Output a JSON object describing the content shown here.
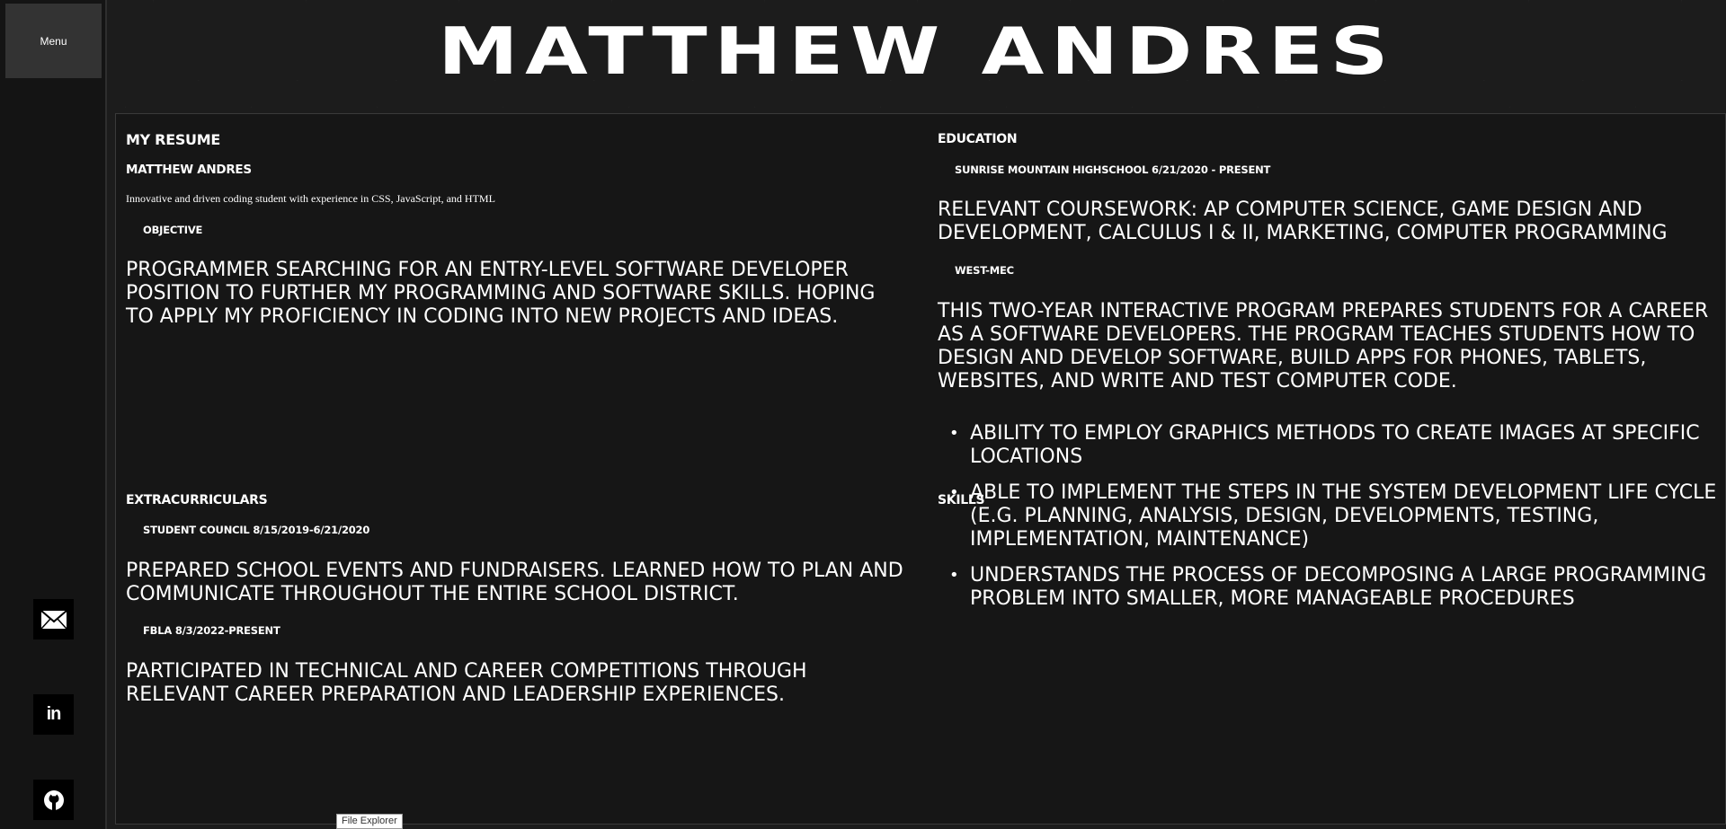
{
  "sidebar": {
    "menu_label": "Menu",
    "social_icons": [
      "mail-icon",
      "linkedin-icon",
      "github-icon"
    ],
    "linkedin_glyph": "in"
  },
  "header": {
    "name": "MATTHEW ANDRES"
  },
  "resume": {
    "title": "MY RESUME",
    "name": "MATTHEW ANDRES",
    "tagline": "Innovative and driven coding student with experience in CSS, JavaScript, and HTML",
    "objective": {
      "heading": "OBJECTIVE",
      "text": "Programmer searching for an entry-level software developer position to further my programming and software skills. Hoping to apply my proficiency in coding into new projects and ideas."
    },
    "education": {
      "heading": "EDUCATION",
      "school": "SUNRISE MOUNTAIN HIGHSCHOOL 6/21/2020 - PRESENT",
      "coursework": "Relevant coursework: AP Computer Science, Game Design and Development, Calculus I & II, Marketing, Computer Programming",
      "program_heading": "WEST-MEC",
      "program_text": "This two-year interactive program prepares students for a career as a software developers. The program teaches students how to design and develop software, build apps for phones, tablets, websites, and write and test computer code."
    },
    "extracurriculars": {
      "heading": "EXTRACURRICULARS",
      "items": [
        {
          "heading": "STUDENT COUNCIL 8/15/2019-6/21/2020",
          "text": "Prepared school events and fundraisers. Learned how to plan and communicate throughout the entire school district."
        },
        {
          "heading": "FBLA 8/3/2022-PRESENT",
          "text": "Participated in technical and career competitions through relevant career preparation and leadership experiences."
        }
      ]
    },
    "skills": {
      "heading": "SKILLS",
      "items": [
        "Ability to employ graphics methods to create images at specific locations",
        "Able to implement the steps in the system development life cycle (e.g. planning, analysis, design, developments, testing, implementation, maintenance)",
        "Understands the process of decomposing a large programming problem into smaller, more manageable procedures"
      ]
    }
  },
  "tooltip": "File Explorer",
  "colors": {
    "background": "#1c1c1c",
    "sidebar": "#141414",
    "menu_button": "#333333",
    "text": "#ffffff"
  }
}
